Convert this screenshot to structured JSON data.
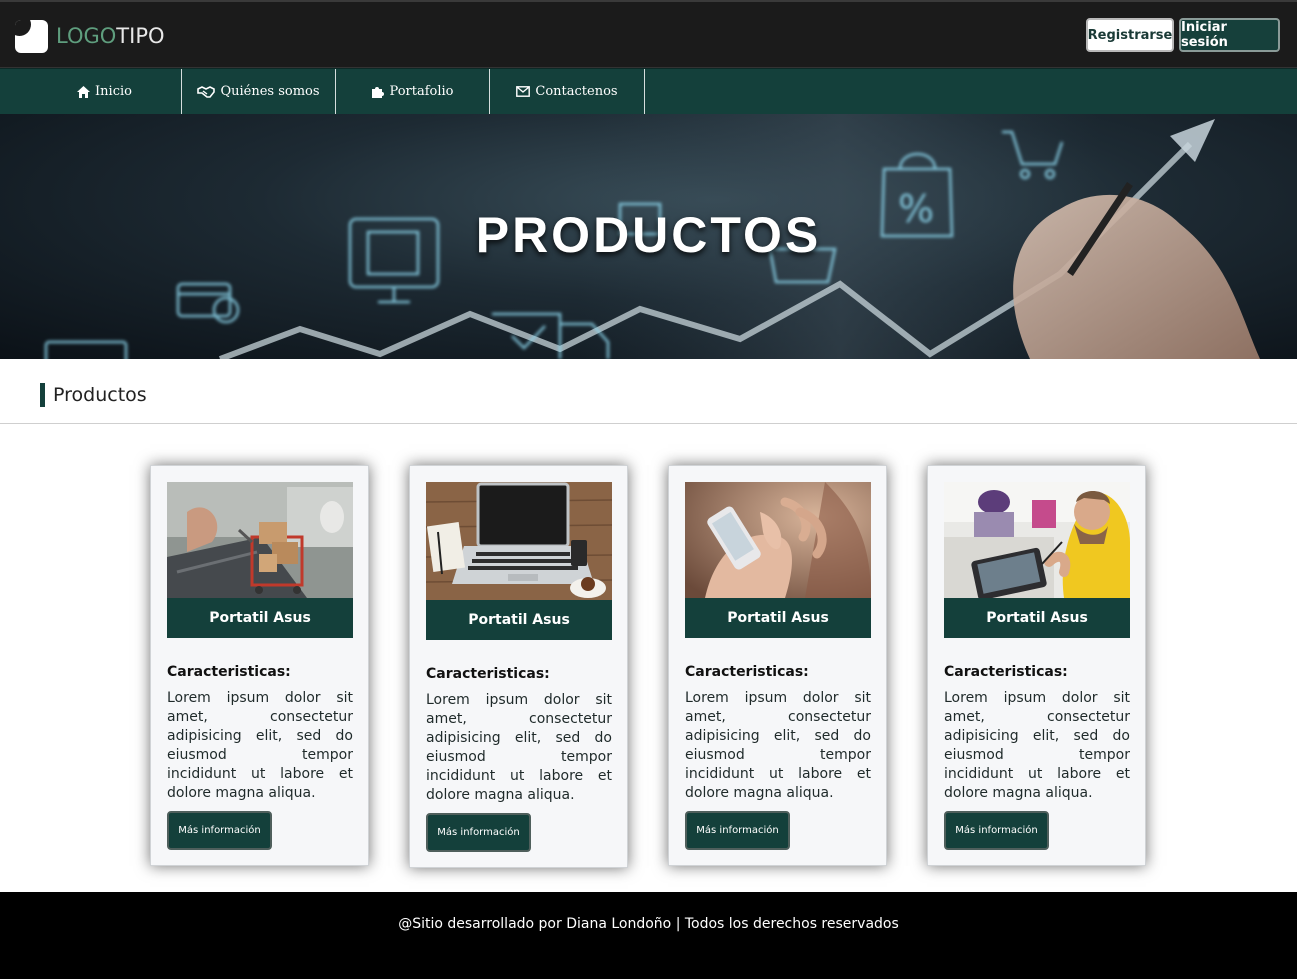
{
  "header": {
    "logo_part1": "LOGO",
    "logo_part2": "TIPO",
    "register_label": "Registrarse",
    "login_label": "Iniciar sesión"
  },
  "nav": {
    "items": [
      {
        "label": "Inicio",
        "icon": "home-icon"
      },
      {
        "label": "Quiénes somos",
        "icon": "handshake-icon"
      },
      {
        "label": "Portafolio",
        "icon": "puzzle-icon"
      },
      {
        "label": "Contactenos",
        "icon": "envelope-icon"
      }
    ]
  },
  "hero": {
    "title": "PRODUCTOS"
  },
  "section": {
    "title": "Productos"
  },
  "cards": [
    {
      "title": "Portatil Asus",
      "subtitle": "Caracteristicas:",
      "text": "Lorem ipsum dolor sit amet, consectetur adipisicing elit, sed do eiusmod tempor incididunt ut labore et dolore magna aliqua.",
      "button": "Más información",
      "image": "shopping-cart-laptop-photo"
    },
    {
      "title": "Portatil Asus",
      "subtitle": "Caracteristicas:",
      "text": "Lorem ipsum dolor sit amet, consectetur adipisicing elit, sed do eiusmod tempor incididunt ut labore et dolore magna aliqua.",
      "button": "Más información",
      "image": "laptop-desk-photo"
    },
    {
      "title": "Portatil Asus",
      "subtitle": "Caracteristicas:",
      "text": "Lorem ipsum dolor sit amet, consectetur adipisicing elit, sed do eiusmod tempor incididunt ut labore et dolore magna aliqua.",
      "button": "Más información",
      "image": "smartphone-hands-photo"
    },
    {
      "title": "Portatil Asus",
      "subtitle": "Caracteristicas:",
      "text": "Lorem ipsum dolor sit amet, consectetur adipisicing elit, sed do eiusmod tempor incididunt ut labore et dolore magna aliqua.",
      "button": "Más información",
      "image": "tablet-drawing-photo"
    }
  ],
  "footer": {
    "text": "@Sitio desarrollado por Diana Londoño | Todos los derechos reservados"
  },
  "colors": {
    "primary": "#14403b",
    "topbar": "#1b1b1b",
    "footer": "#000000",
    "logo_accent": "#5f9e7e"
  }
}
